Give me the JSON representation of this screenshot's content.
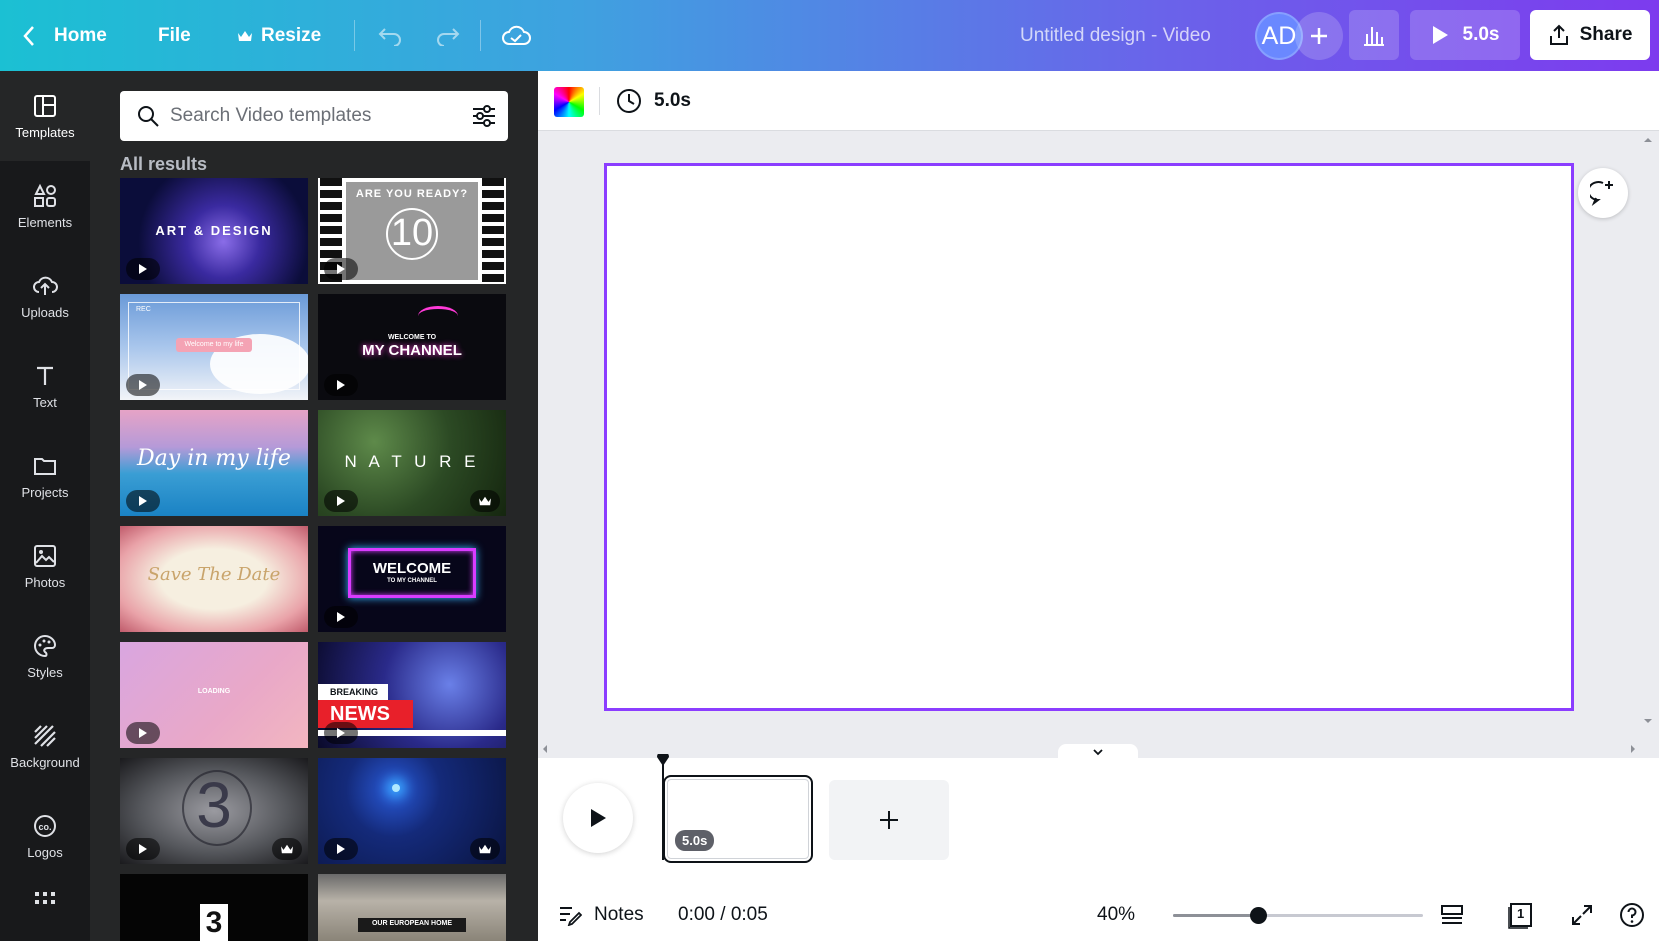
{
  "topbar": {
    "home_label": "Home",
    "file_label": "File",
    "resize_label": "Resize",
    "design_title": "Untitled design - Video",
    "avatar_initials": "AD",
    "play_duration": "5.0s",
    "share_label": "Share"
  },
  "rail": {
    "items": [
      {
        "label": "Templates",
        "icon": "templates-icon"
      },
      {
        "label": "Elements",
        "icon": "elements-icon"
      },
      {
        "label": "Uploads",
        "icon": "uploads-icon"
      },
      {
        "label": "Text",
        "icon": "text-icon"
      },
      {
        "label": "Projects",
        "icon": "projects-icon"
      },
      {
        "label": "Photos",
        "icon": "photos-icon"
      },
      {
        "label": "Styles",
        "icon": "styles-icon"
      },
      {
        "label": "Background",
        "icon": "background-icon"
      },
      {
        "label": "Logos",
        "icon": "logos-icon"
      },
      {
        "label": "",
        "icon": "apps-icon"
      }
    ]
  },
  "panel": {
    "search_placeholder": "Search Video templates",
    "results_label": "All results",
    "templates": [
      {
        "title": "ART & DESIGN",
        "premium": false
      },
      {
        "title": "ARE YOU READY?",
        "number": "10",
        "premium": false
      },
      {
        "title": "Welcome to my life",
        "badge": "REC",
        "premium": false
      },
      {
        "title": "MY CHANNEL",
        "subtitle": "WELCOME TO",
        "premium": false
      },
      {
        "title": "Day in my life",
        "premium": false
      },
      {
        "title": "N A T U R E",
        "premium": true
      },
      {
        "title": "Save The Date",
        "premium": false
      },
      {
        "title": "WELCOME",
        "subtitle": "TO MY CHANNEL",
        "premium": false
      },
      {
        "title": "LOADING",
        "premium": false
      },
      {
        "title": "NEWS",
        "subtitle": "BREAKING",
        "premium": false
      },
      {
        "title": "3",
        "premium": true
      },
      {
        "title": "",
        "premium": true
      },
      {
        "title": "3",
        "premium": false
      },
      {
        "title": "OUR EUROPEAN HOME",
        "premium": false
      }
    ]
  },
  "editor": {
    "duration_label": "5.0s"
  },
  "timeline": {
    "clip_duration": "5.0s",
    "notes_label": "Notes",
    "time_readout": "0:00 / 0:05",
    "zoom_label": "40%",
    "zoom_value": 0.34,
    "page_count": "1"
  },
  "colors": {
    "accent": "#8b3dff",
    "rail_bg": "#18191b",
    "panel_bg": "#252627"
  }
}
